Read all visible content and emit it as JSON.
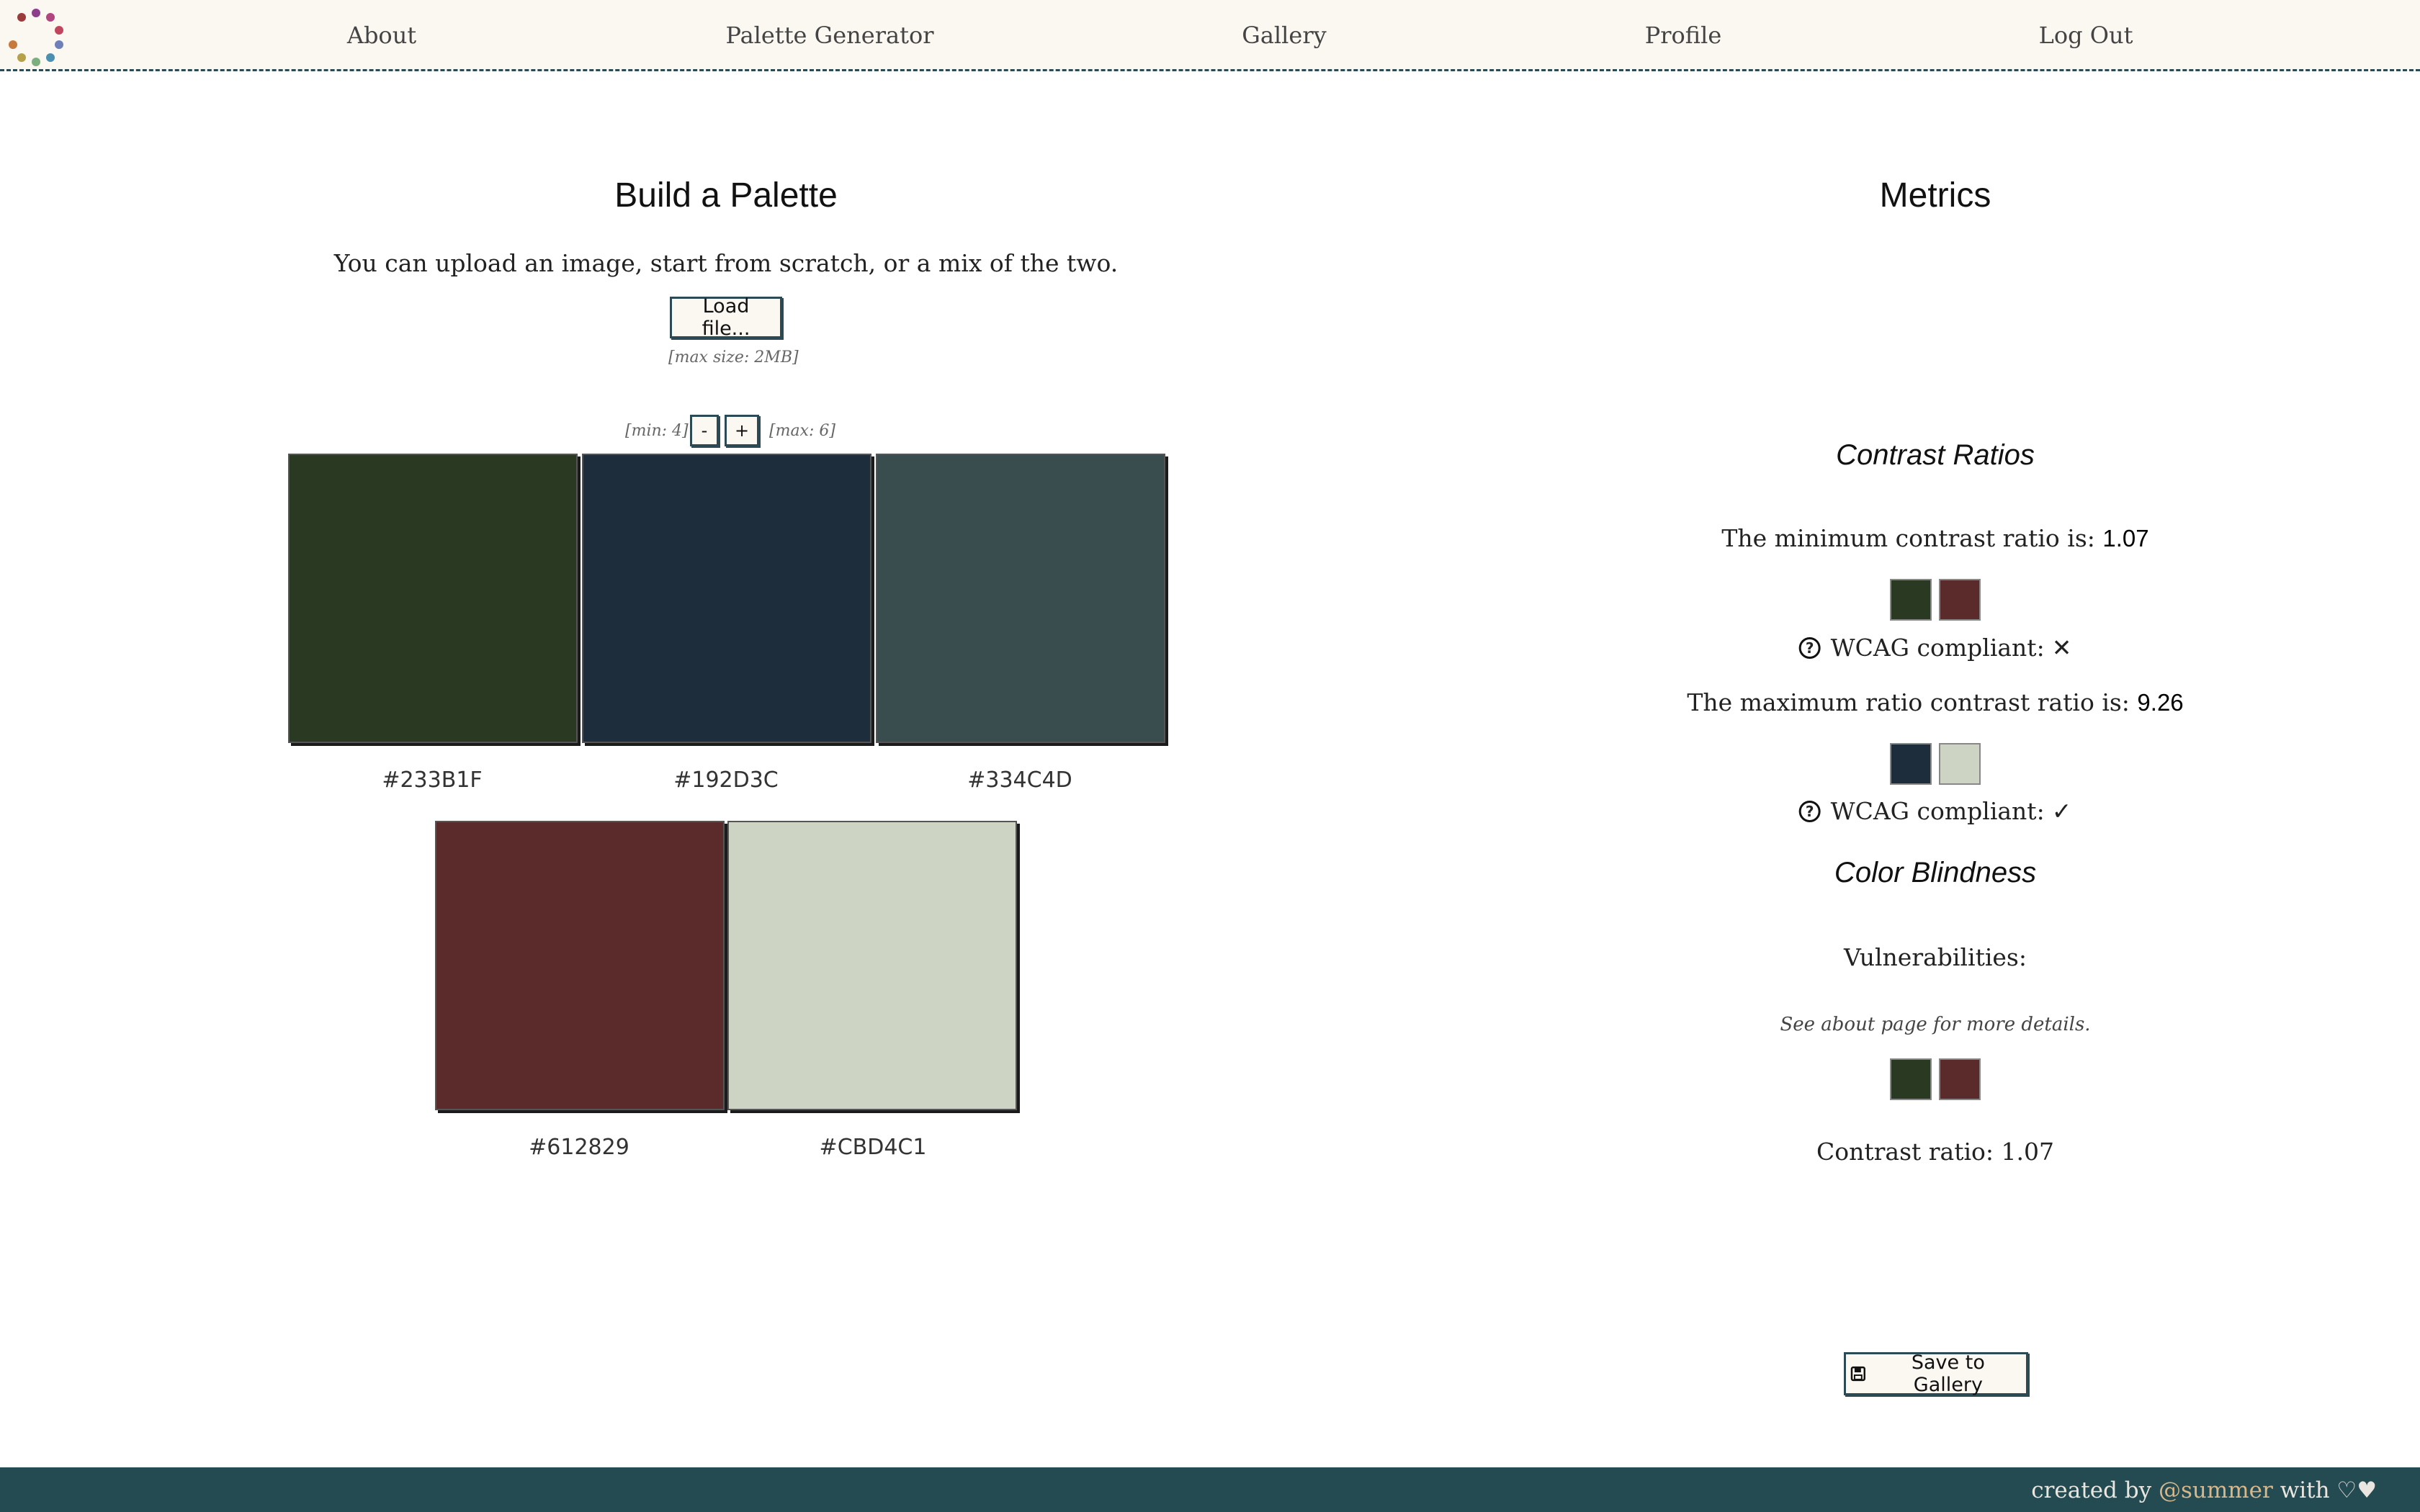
{
  "header": {
    "nav": [
      {
        "label": "About"
      },
      {
        "label": "Palette Generator"
      },
      {
        "label": "Gallery"
      },
      {
        "label": "Profile"
      },
      {
        "label": "Log Out"
      }
    ],
    "logo_dot_colors": [
      "#8e3f8c",
      "#b0457f",
      "#c2455e",
      "#6f7fb9",
      "#4b8fb1",
      "#7bb07e",
      "#b4a14a",
      "#c77a3d",
      "#9b3b3b"
    ]
  },
  "builder": {
    "title": "Build a Palette",
    "description": "You can upload an image, start from scratch, or a mix of the two.",
    "load_button": "Load file...",
    "max_size_note": "[max size: 2MB]",
    "min_note": "[min: 4]",
    "max_note": "[max: 6]",
    "minus_label": "-",
    "plus_label": "+",
    "swatches": [
      {
        "hex": "#233B1F",
        "color": "#2a3a22"
      },
      {
        "hex": "#192D3C",
        "color": "#1e2d3c"
      },
      {
        "hex": "#334C4D",
        "color": "#394c4e"
      },
      {
        "hex": "#612829",
        "color": "#5b2b2c"
      },
      {
        "hex": "#CBD4C1",
        "color": "#ced4c4"
      }
    ]
  },
  "metrics": {
    "title": "Metrics",
    "contrast_title": "Contrast Ratios",
    "min_prefix": "The minimum contrast ratio is:",
    "min_value": "1.07",
    "min_pair": [
      "#2a3a22",
      "#5b2b2c"
    ],
    "wcag_label": "WCAG compliant:",
    "min_wcag_mark": "✕",
    "max_prefix": "The maximum ratio contrast ratio is:",
    "max_value": "9.26",
    "max_pair": [
      "#1e2d3c",
      "#ced4c4"
    ],
    "max_wcag_mark": "✓",
    "color_blindness_title": "Color Blindness",
    "vulnerabilities_label": "Vulnerabilities:",
    "about_note": "See about page for more details.",
    "vuln_pair": [
      "#2a3a22",
      "#5b2b2c"
    ],
    "vuln_contrast": "Contrast ratio: 1.07",
    "save_button": "Save to Gallery"
  },
  "footer": {
    "prefix": "created by",
    "author": "@summer",
    "suffix": "with ♡♥"
  }
}
